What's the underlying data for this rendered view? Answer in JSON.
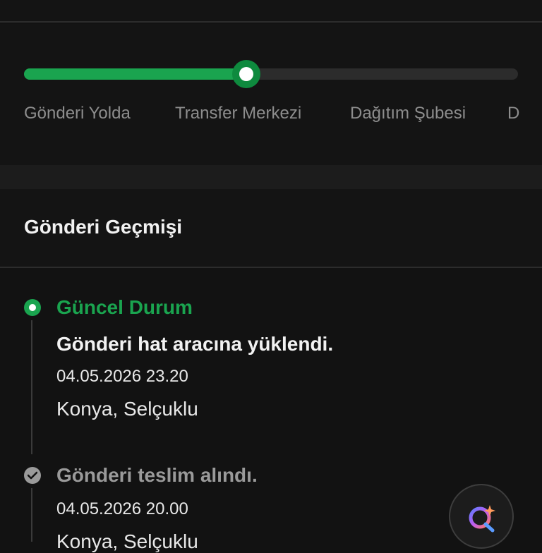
{
  "progress": {
    "value_fraction": 0.45,
    "steps": [
      {
        "label": "Gönderi Yolda"
      },
      {
        "label": "Transfer Merkezi"
      },
      {
        "label": "Dağıtım Şubesi"
      },
      {
        "label": "D"
      }
    ],
    "accent_color": "#1aa44f"
  },
  "history": {
    "title": "Gönderi Geçmişi",
    "events": [
      {
        "status": "Güncel Durum",
        "description": "Gönderi hat aracına yüklendi.",
        "datetime": "04.05.2026 23.20",
        "location": "Konya, Selçuklu",
        "icon": "current-dot-icon"
      },
      {
        "status": "Gönderi teslim alındı.",
        "datetime": "04.05.2026 20.00",
        "location": "Konya, Selçuklu",
        "icon": "check-circle-icon"
      }
    ]
  },
  "assistant_button": {
    "icon": "ai-assistant-icon"
  }
}
